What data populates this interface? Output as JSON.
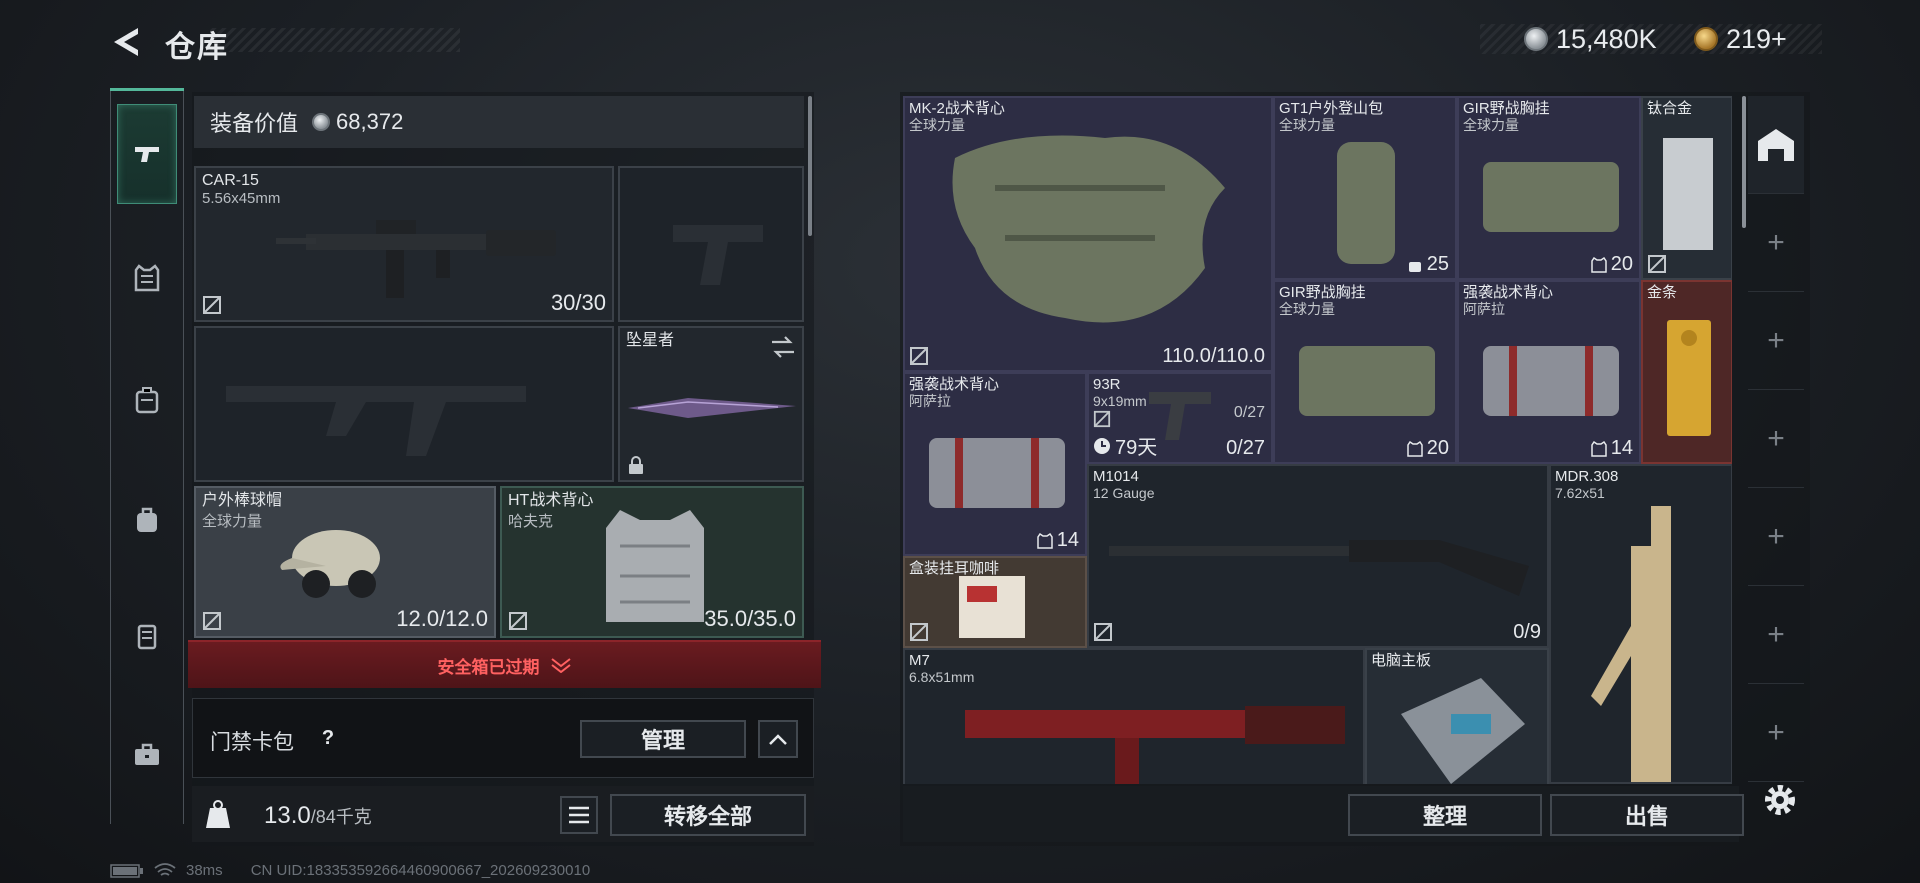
{
  "header": {
    "title": "仓库",
    "silver_amount": "15,480K",
    "gold_amount": "219+",
    "plus": "+"
  },
  "equipment": {
    "value_label": "装备价值",
    "value_amount": "68,372",
    "slots": [
      {
        "name": "CAR-15",
        "sub": "5.56x45mm",
        "value": "30/30"
      },
      {
        "name": "",
        "sub": "",
        "value": ""
      },
      {
        "name": "",
        "sub": "",
        "value": ""
      },
      {
        "name": "坠星者",
        "sub": "",
        "value": ""
      },
      {
        "name": "户外棒球帽",
        "sub": "全球力量",
        "value": "12.0/12.0"
      },
      {
        "name": "HT战术背心",
        "sub": "哈夫克",
        "value": "35.0/35.0"
      }
    ],
    "safe_box_status": "安全箱已过期",
    "card_pack_label": "门禁卡包",
    "help_glyph": "?",
    "manage_label": "管理",
    "weight_value": "13.0",
    "weight_capacity": "/84千克",
    "transfer_all_label": "转移全部"
  },
  "storage": {
    "items": [
      {
        "name": "MK-2战术背心",
        "sub": "全球力量",
        "value": "110.0/110.0"
      },
      {
        "name": "GT1户外登山包",
        "sub": "全球力量",
        "value": "25"
      },
      {
        "name": "GIR野战胸挂",
        "sub": "全球力量",
        "value": "20"
      },
      {
        "name": "钛合金",
        "sub": "",
        "value": ""
      },
      {
        "name": "GIR野战胸挂",
        "sub": "全球力量",
        "value": ""
      },
      {
        "name": "强袭战术背心",
        "sub": "阿萨拉",
        "value": "14"
      },
      {
        "name": "金条",
        "sub": "",
        "value": ""
      },
      {
        "name": "强袭战术背心",
        "sub": "阿萨拉",
        "value": "14"
      },
      {
        "name": "93R",
        "sub": "9x19mm",
        "value": "0/27",
        "extra": "79天",
        "extra2": "0/27"
      },
      {
        "name": "M1014",
        "sub": "12 Gauge",
        "value": "0/9"
      },
      {
        "name": "MDR.308",
        "sub": "7.62x51",
        "value": ""
      },
      {
        "name": "盒装挂耳咖啡",
        "sub": "",
        "value": ""
      },
      {
        "name": "M7",
        "sub": "6.8x51mm",
        "value": ""
      },
      {
        "name": "电脑主板",
        "sub": "",
        "value": ""
      }
    ],
    "gir_count": "20",
    "sort_label": "整理",
    "sell_label": "出售"
  },
  "footer": {
    "ping": "38ms",
    "uid": "CN UID:18335359266446090066​7_202609230010"
  },
  "colors": {
    "accent": "#54b89a",
    "alert": "#ff6161",
    "purple_cell": "#2d2d44",
    "red_cell": "#4e2726"
  }
}
